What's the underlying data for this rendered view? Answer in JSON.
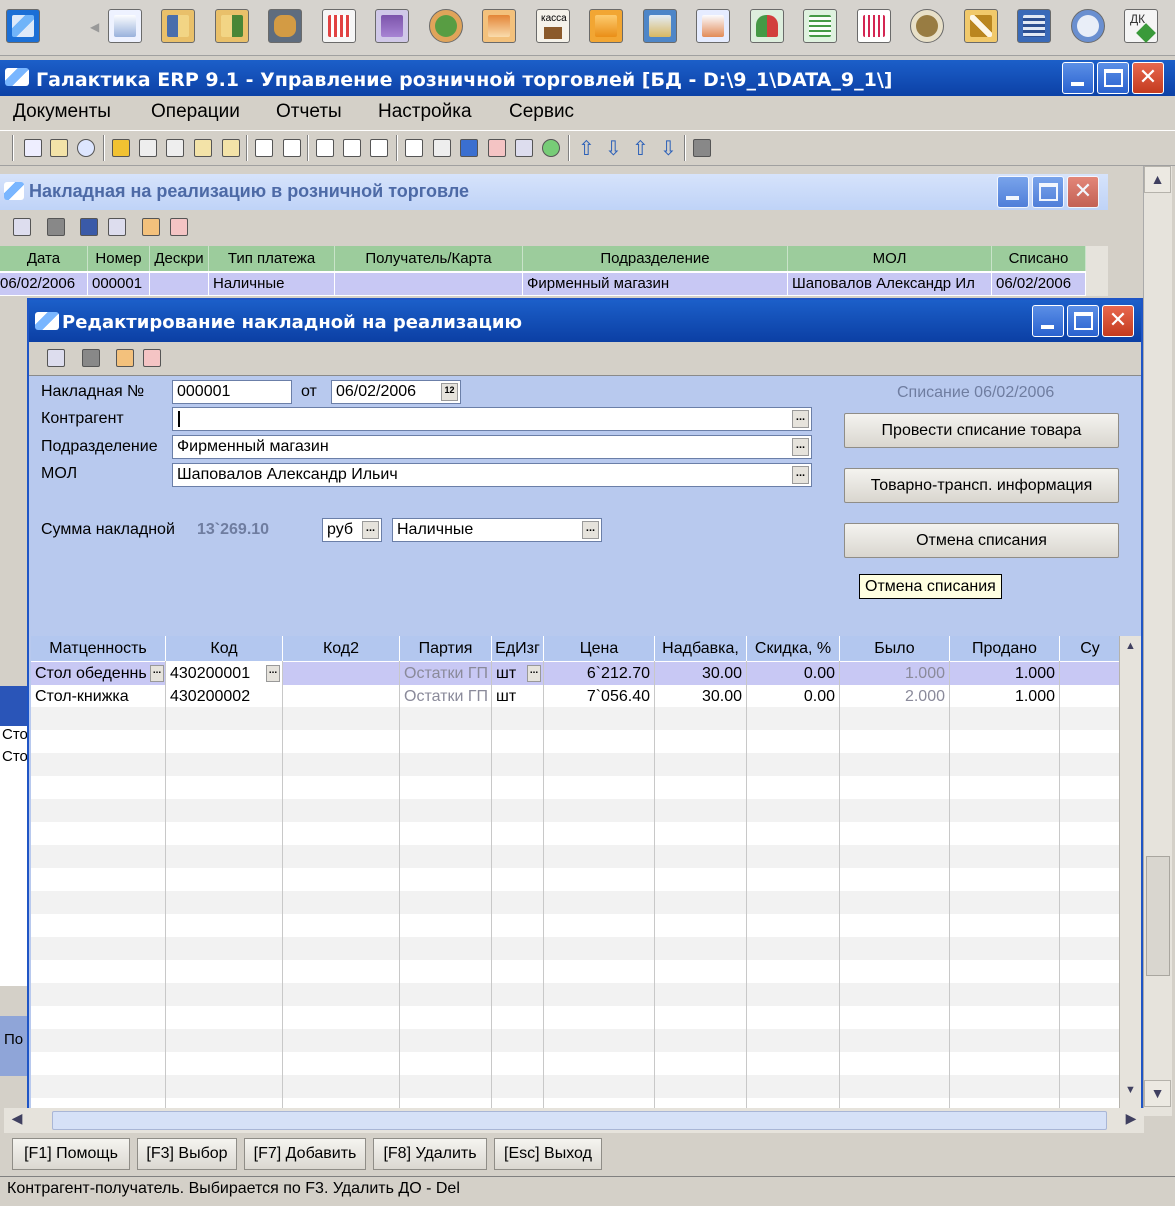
{
  "app": {
    "title": "Галактика ERP 9.1 - Управление розничной торговлей [БД - D:\\9_1\\DATA_9_1\\]"
  },
  "toolbar_icons": [
    "document-icon",
    "import-icon",
    "export-icon",
    "database-icon",
    "chart-icon",
    "factory-chart-icon",
    "recycle-icon",
    "network-icon",
    "kassa-icon",
    "folder-icon",
    "mail-icon",
    "contract-icon",
    "users-icon",
    "report-icon",
    "grid-report-icon",
    "compass-icon",
    "tools-icon",
    "building-icon",
    "settings-icon",
    "dk-icon"
  ],
  "kassa_label": "касса",
  "dk_label": "ДК",
  "menu": [
    "Документы",
    "Операции",
    "Отчеты",
    "Настройка",
    "Сервис"
  ],
  "back_window": {
    "title": "Накладная на реализацию в розничной торговле",
    "columns": [
      "Дата",
      "Номер",
      "Дескри",
      "Тип платежа",
      "Получатель/Карта",
      "Подразделение",
      "МОЛ",
      "Списано"
    ],
    "row": [
      "06/02/2006",
      "000001",
      "",
      "Наличные",
      "",
      "Фирменный магазин",
      "Шаповалов Александр Ил",
      "06/02/2006"
    ],
    "left_fragments": [
      "Сто",
      "Сто",
      "По"
    ]
  },
  "edit": {
    "title": "Редактирование накладной на реализацию",
    "invoice_label": "Накладная №",
    "invoice_no": "000001",
    "from_label": "от",
    "date": "06/02/2006",
    "writeoff_note": "Списание 06/02/2006",
    "contractor_label": "Контрагент",
    "contractor_value": "",
    "dept_label": "Подразделение",
    "dept_value": "Фирменный магазин",
    "mol_label": "МОЛ",
    "mol_value": "Шаповалов Александр Ильич",
    "sum_label": "Сумма накладной",
    "sum_value": "13`269.10",
    "currency": "руб",
    "payment": "Наличные",
    "btn_writeoff": "Провести списание товара",
    "btn_transport": "Товарно-трансп. информация",
    "btn_cancel": "Отмена списания",
    "tooltip": "Отмена списания"
  },
  "grid": {
    "columns": [
      "Матценность",
      "Код",
      "Код2",
      "Партия",
      "ЕдИзг",
      "Цена",
      "Надбавка,",
      "Скидка, %",
      "Было",
      "Продано",
      "Су"
    ],
    "rows": [
      [
        "Стол обеденнь",
        "430200001",
        "",
        "Остатки ГП",
        "шт",
        "6`212.70",
        "30.00",
        "0.00",
        "1.000",
        "1.000"
      ],
      [
        "Стол-книжка",
        "430200002",
        "",
        "Остатки ГП",
        "шт",
        "7`056.40",
        "30.00",
        "0.00",
        "2.000",
        "1.000"
      ]
    ]
  },
  "fkeys": [
    "[F1] Помощь",
    "[F3] Выбор",
    "[F7] Добавить",
    "[F8] Удалить",
    "[Esc] Выход"
  ],
  "status": "Контрагент-получатель. Выбирается по F3. Удалить ДО - Del",
  "colors": {
    "title_blue": "#0b3fa4",
    "grid_header_green": "#9ccc9c",
    "selected_row": "#c8c8f4",
    "edit_bg": "#b8c9ee"
  }
}
